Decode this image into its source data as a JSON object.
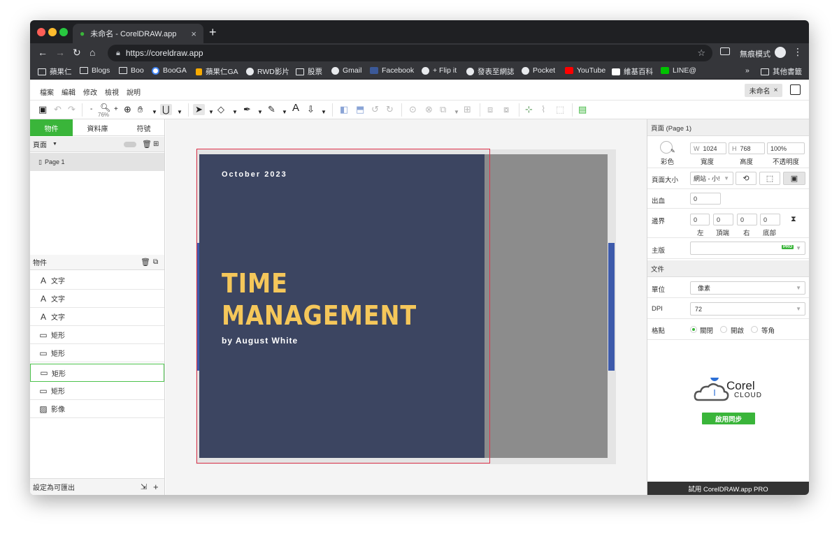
{
  "browser": {
    "tab_title": "未命名 - CorelDRAW.app",
    "url": "https://coreldraw.app",
    "incognito_label": "無痕模式",
    "bookmarks": [
      "蘋果仁",
      "Blogs",
      "Boo",
      "BooGA",
      "蘋果仁GA",
      "RWD影片",
      "股票",
      "Gmail",
      "Facebook",
      "+ Flip it",
      "發表至網誌",
      "Pocket",
      "YouTube",
      "維基百科",
      "LINE@"
    ],
    "more_bookmarks": "»",
    "other_bookmarks": "其他書籤"
  },
  "menubar": {
    "items": [
      "檔案",
      "編輯",
      "修改",
      "檢視",
      "說明"
    ],
    "doc_name": "未命名"
  },
  "toolbar": {
    "zoom": "76%"
  },
  "left_panel": {
    "tabs": [
      "物件",
      "資料庫",
      "符號"
    ],
    "pages_header": "頁面",
    "page_item": "Page 1",
    "objects_header": "物件",
    "objects": [
      {
        "type": "text",
        "label": "文字"
      },
      {
        "type": "text",
        "label": "文字"
      },
      {
        "type": "text",
        "label": "文字"
      },
      {
        "type": "rect",
        "label": "矩形"
      },
      {
        "type": "rect",
        "label": "矩形"
      },
      {
        "type": "rect",
        "label": "矩形"
      },
      {
        "type": "rect",
        "label": "矩形"
      },
      {
        "type": "image",
        "label": "影像"
      }
    ],
    "footer": "設定為可匯出"
  },
  "canvas": {
    "date": "October 2023",
    "headline_1": "TIME",
    "headline_2": "MANAGEMENT",
    "author": "by August White"
  },
  "right_panel": {
    "page_header": "頁面 (Page 1)",
    "color_label": "彩色",
    "width_prefix": "W",
    "width": "1024",
    "width_label": "寬度",
    "height_prefix": "H",
    "height": "768",
    "height_label": "高度",
    "opacity": "100%",
    "opacity_label": "不透明度",
    "page_size_label": "頁面大小",
    "page_size_value": "網站 - 小!",
    "bleed_label": "出血",
    "bleed_value": "0",
    "margin_label": "邊界",
    "margins": [
      {
        "value": "0",
        "label": "左"
      },
      {
        "value": "0",
        "label": "頂端"
      },
      {
        "value": "0",
        "label": "右"
      },
      {
        "value": "0",
        "label": "底部"
      }
    ],
    "master_label": "主版",
    "pro_badge": "PRO",
    "doc_header": "文件",
    "unit_label": "單位",
    "unit_value": "像素",
    "dpi_label": "DPI",
    "dpi_value": "72",
    "grid_label": "格點",
    "grid_options": [
      "關閉",
      "開啟",
      "等角"
    ],
    "grid_selected": "關閉",
    "corel_word": "Corel",
    "cloud_word": "CLOUD",
    "sync_button": "啟用同步",
    "pro_footer": "試用 CorelDRAW.app PRO"
  },
  "colors": {
    "accent_green": "#3ab53a",
    "slide_navy": "#3c4561",
    "headline_yellow": "#f5c75a",
    "selection_red": "#e0324b",
    "side_blue": "#3d5aab"
  }
}
